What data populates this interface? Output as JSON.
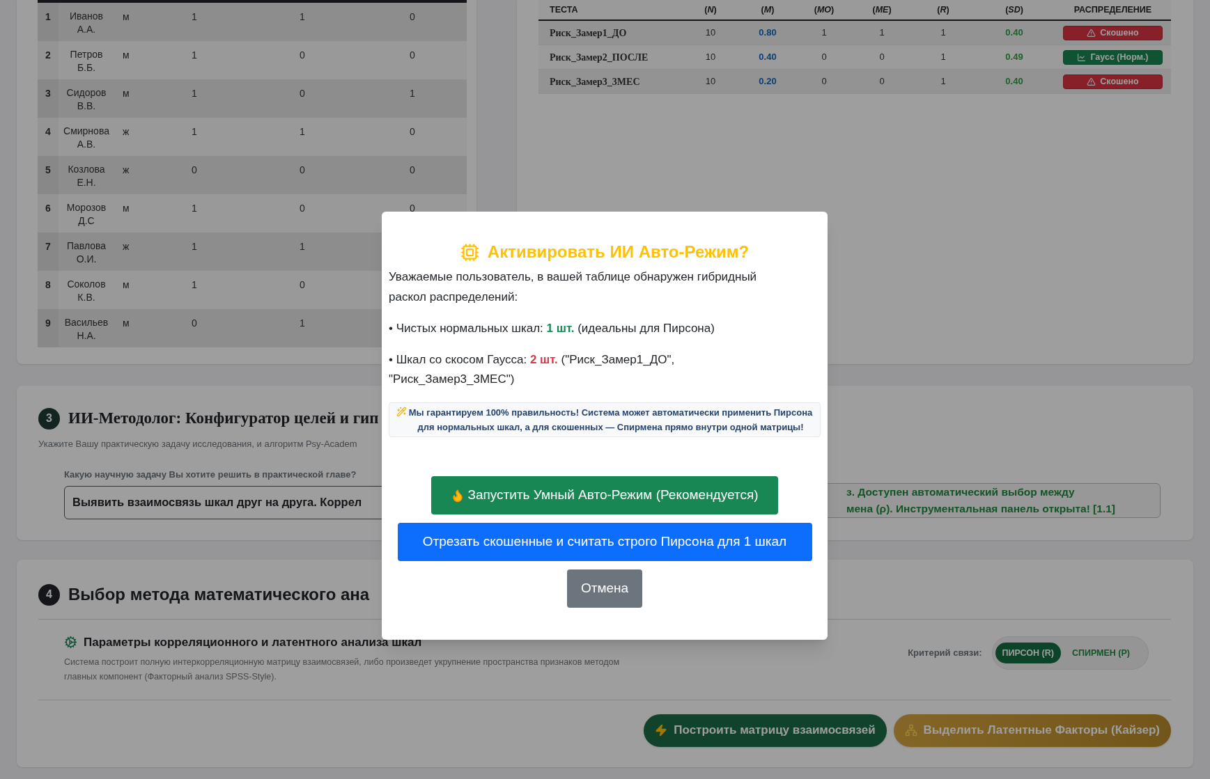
{
  "scores_table": {
    "rows": [
      {
        "num": "1",
        "name": "Иванов А.А.",
        "gender": "м",
        "values": [
          "1",
          "1",
          "0"
        ]
      },
      {
        "num": "2",
        "name": "Петров Б.Б.",
        "gender": "м",
        "values": [
          "1",
          "0",
          "0"
        ]
      },
      {
        "num": "3",
        "name": "Сидоров В.В.",
        "gender": "м",
        "values": [
          "1",
          "0",
          "1"
        ]
      },
      {
        "num": "4",
        "name": "Смирнова А.В.",
        "gender": "ж",
        "values": [
          "1",
          "1",
          "0"
        ]
      },
      {
        "num": "5",
        "name": "Козлова Е.Н.",
        "gender": "ж",
        "values": [
          "0",
          "0",
          "0"
        ]
      },
      {
        "num": "6",
        "name": "Морозов Д.С",
        "gender": "м",
        "values": [
          "1",
          "0",
          "0"
        ]
      },
      {
        "num": "7",
        "name": "Павлова О.И.",
        "gender": "ж",
        "values": [
          "1",
          "1"
        ]
      },
      {
        "num": "8",
        "name": "Соколов К.В.",
        "gender": "м",
        "values": [
          "1",
          "0"
        ]
      },
      {
        "num": "9",
        "name": "Васильев Н.А.",
        "gender": "м",
        "values": [
          "0",
          "1"
        ]
      }
    ]
  },
  "stats_table": {
    "columns": [
      "ТЕСТА",
      "(*N*)",
      "(*M*)",
      "(*MO*)",
      "(*ME*)",
      "(*R*)",
      "(*SD*)",
      "РАСПРЕДЕЛЕНИЕ"
    ],
    "rows": [
      {
        "test": "Риск_Замер1_ДО",
        "n": "10",
        "m": "0.80",
        "mo": "1",
        "me": "1",
        "r": "1",
        "sd": "0.40",
        "distribution": {
          "kind": "skewed",
          "label": "Скошено"
        }
      },
      {
        "test": "Риск_Замер2_ПОСЛЕ",
        "n": "10",
        "m": "0.40",
        "mo": "0",
        "me": "0",
        "r": "1",
        "sd": "0.49",
        "distribution": {
          "kind": "normal",
          "label": "Гаусс (Норм.)"
        }
      },
      {
        "test": "Риск_Замер3_3МЕС",
        "n": "10",
        "m": "0.20",
        "mo": "0",
        "me": "0",
        "r": "1",
        "sd": "0.40",
        "distribution": {
          "kind": "skewed",
          "label": "Скошено"
        }
      }
    ]
  },
  "section_3": {
    "number": "3",
    "title": "ИИ-Методолог: Конфигуратор целей и гип",
    "subtitle": "Укажите Вашу практическую задачу исследования, и алгоритм Psy-Academ",
    "question_label": "Какую научную задачу Вы хотите решить в практической главе?",
    "answer": {
      "value": "Выявить взаимосвязь шкал друг на друга. Коррел"
    },
    "notice": [
      "з. Доступен автоматический выбор между",
      "мена (ρ). Инструментальная панель открыта! [1.1]"
    ]
  },
  "section_4": {
    "number": "4",
    "title": "Выбор метода математического ана",
    "params": {
      "title": "Параметры корреляционного и латентного анализа шкал",
      "description": "Система построит полную интеркорреляционную матрицу взаимосвязей, либо произведет укрупнение пространства признаков методом главных компонент (Факторный анализ SPSS-Style)."
    },
    "criterion": {
      "label": "Критерий связи:",
      "options": [
        {
          "label": "ПИРСОН (R)",
          "selected": true
        },
        {
          "label": "СПИРМЕН (Р)",
          "selected": false
        }
      ]
    },
    "actions": [
      {
        "label": "Построить матрицу взаимосвязей",
        "kind": "matrix"
      },
      {
        "label": "Выделить Латентные Факторы (Кайзер)",
        "kind": "factors"
      }
    ]
  },
  "dialog": {
    "title": "Активировать ИИ Авто-Режим?",
    "intro": "Уважаемые пользователь, в вашей таблице обнаружен гибридный раскол распределений:",
    "bullets": [
      {
        "prefix": "• Чистых нормальных шкал: ",
        "count": "1 шт.",
        "suffix": " (идеальны для Пирсона)",
        "kind": "normal"
      },
      {
        "prefix": "• Шкал со скосом Гаусса: ",
        "count": "2 шт.",
        "suffix": " (\"Риск_Замер1_ДО\", \"Риск_Замер3_3МЕС\")",
        "kind": "skewed"
      }
    ],
    "note": "Мы гарантируем 100% правильность! Система может автоматически применить Пирсона для нормальных шкал, а для скошенных — Спирмена прямо внутри одной матрицы!",
    "buttons": [
      {
        "label": "Запустить Умный Авто-Режим (Рекомендуется)",
        "kind": "auto"
      },
      {
        "label": "Отрезать скошенные и считать строго Пирсона для 1 шкал",
        "kind": "cut"
      },
      {
        "label": "Отмена",
        "kind": "cancel"
      }
    ]
  }
}
